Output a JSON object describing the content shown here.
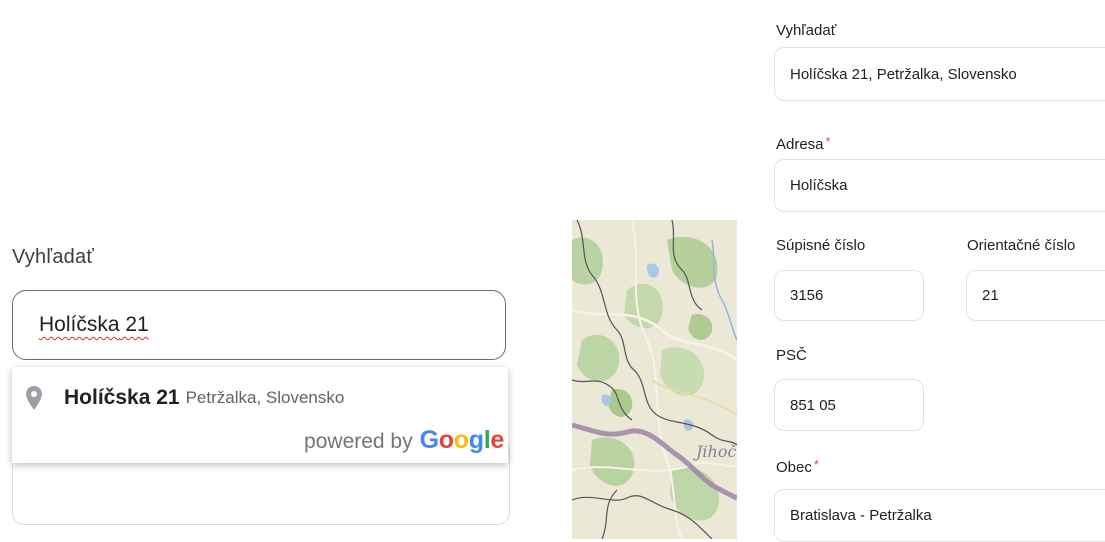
{
  "left_search": {
    "label": "Vyhľadať",
    "value_first": "Holíčska",
    "value_rest": " 21",
    "suggestion": {
      "main_bold": "Holíčska",
      "main_rest": " 21",
      "secondary": "Petržalka, Slovensko"
    },
    "powered_by": "powered by",
    "google_logo": [
      "G",
      "o",
      "o",
      "g",
      "l",
      "e"
    ]
  },
  "map": {
    "label": "Jihoč"
  },
  "form": {
    "search": {
      "label": "Vyhľadať",
      "value": "Holíčska 21, Petržalka, Slovensko"
    },
    "address": {
      "label": "Adresa",
      "required": "*",
      "value": "Holíčska"
    },
    "supisne": {
      "label": "Súpisné číslo",
      "value": "3156"
    },
    "orientacne": {
      "label": "Orientačné číslo",
      "value": "21"
    },
    "psc": {
      "label": "PSČ",
      "value": "851 05"
    },
    "obec": {
      "label": "Obec",
      "required": "*",
      "value": "Bratislava - Petržalka"
    }
  },
  "colors": {
    "required": "#e54848",
    "google_blue": "#4285f4",
    "google_red": "#ea4335",
    "google_yellow": "#fbbc05",
    "google_green": "#34a853"
  },
  "icons": {
    "suggestion": "map-pin-icon"
  }
}
